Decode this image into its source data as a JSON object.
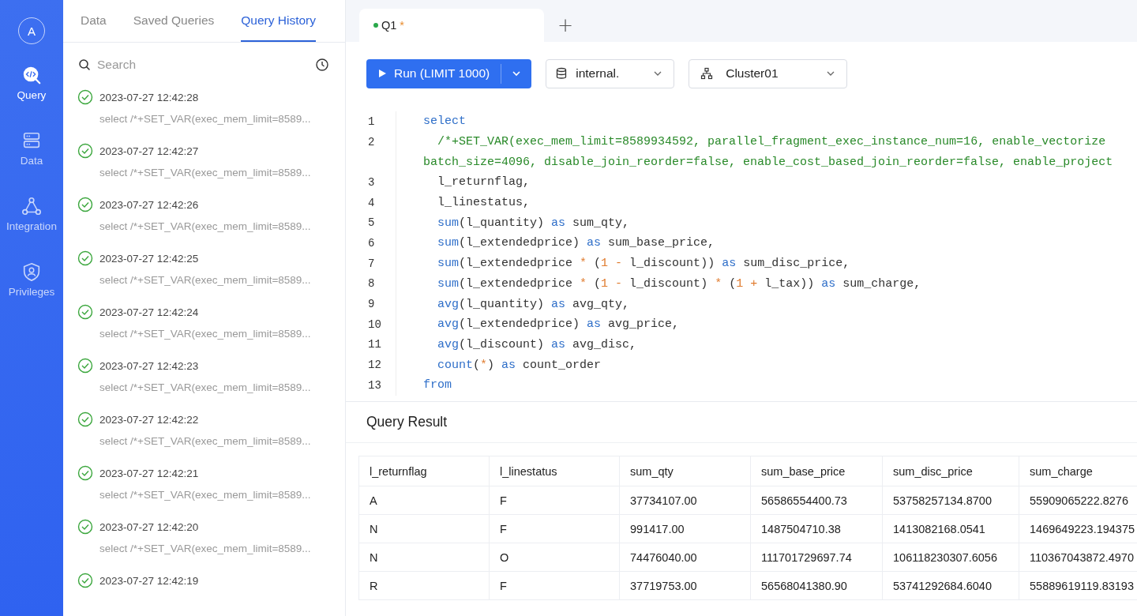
{
  "nav": {
    "avatar": "A",
    "items": [
      {
        "label": "Query",
        "selected": true
      },
      {
        "label": "Data",
        "selected": false
      },
      {
        "label": "Integration",
        "selected": false
      },
      {
        "label": "Privileges",
        "selected": false
      }
    ]
  },
  "panel": {
    "tabs": [
      {
        "label": "Data",
        "selected": false
      },
      {
        "label": "Saved Queries",
        "selected": false
      },
      {
        "label": "Query History",
        "selected": true
      }
    ],
    "search": {
      "placeholder": "Search"
    },
    "history": [
      {
        "time": "2023-07-27 12:42:28",
        "query": "select /*+SET_VAR(exec_mem_limit=8589..."
      },
      {
        "time": "2023-07-27 12:42:27",
        "query": "select /*+SET_VAR(exec_mem_limit=8589..."
      },
      {
        "time": "2023-07-27 12:42:26",
        "query": "select /*+SET_VAR(exec_mem_limit=8589..."
      },
      {
        "time": "2023-07-27 12:42:25",
        "query": "select /*+SET_VAR(exec_mem_limit=8589..."
      },
      {
        "time": "2023-07-27 12:42:24",
        "query": "select /*+SET_VAR(exec_mem_limit=8589..."
      },
      {
        "time": "2023-07-27 12:42:23",
        "query": "select /*+SET_VAR(exec_mem_limit=8589..."
      },
      {
        "time": "2023-07-27 12:42:22",
        "query": "select /*+SET_VAR(exec_mem_limit=8589..."
      },
      {
        "time": "2023-07-27 12:42:21",
        "query": "select /*+SET_VAR(exec_mem_limit=8589..."
      },
      {
        "time": "2023-07-27 12:42:20",
        "query": "select /*+SET_VAR(exec_mem_limit=8589..."
      },
      {
        "time": "2023-07-27 12:42:19"
      }
    ]
  },
  "editor_tabs": [
    {
      "label": "Q1",
      "modified_mark": "*",
      "selected": true
    }
  ],
  "new_tab": "+",
  "toolbar": {
    "run_button": "Run (LIMIT 1000)",
    "database": "internal.",
    "cluster": "Cluster01"
  },
  "code": [
    {
      "number": "1",
      "rows": [
        [
          {
            "kind": "keyword",
            "text": "select"
          }
        ]
      ]
    },
    {
      "number": "2",
      "rows": [
        [
          {
            "kind": "plain",
            "text": "  "
          },
          {
            "kind": "comment",
            "text": "/*+SET_VAR(exec_mem_limit=8589934592, parallel_fragment_exec_instance_num=16, enable_vectorize"
          }
        ],
        [
          {
            "kind": "comment",
            "text": "batch_size=4096, disable_join_reorder=false, enable_cost_based_join_reorder=false, enable_project"
          }
        ]
      ]
    },
    {
      "number": "3",
      "rows": [
        [
          {
            "kind": "plain",
            "text": "  l_returnflag,"
          }
        ]
      ]
    },
    {
      "number": "4",
      "rows": [
        [
          {
            "kind": "plain",
            "text": "  l_linestatus,"
          }
        ]
      ]
    },
    {
      "number": "5",
      "rows": [
        [
          {
            "kind": "plain",
            "text": "  "
          },
          {
            "kind": "keyword",
            "text": "sum"
          },
          {
            "kind": "plain",
            "text": "(l_quantity) "
          },
          {
            "kind": "keyword",
            "text": "as"
          },
          {
            "kind": "plain",
            "text": " sum_qty,"
          }
        ]
      ]
    },
    {
      "number": "6",
      "rows": [
        [
          {
            "kind": "plain",
            "text": "  "
          },
          {
            "kind": "keyword",
            "text": "sum"
          },
          {
            "kind": "plain",
            "text": "(l_extendedprice) "
          },
          {
            "kind": "keyword",
            "text": "as"
          },
          {
            "kind": "plain",
            "text": " sum_base_price,"
          }
        ]
      ]
    },
    {
      "number": "7",
      "rows": [
        [
          {
            "kind": "plain",
            "text": "  "
          },
          {
            "kind": "keyword",
            "text": "sum"
          },
          {
            "kind": "plain",
            "text": "(l_extendedprice "
          },
          {
            "kind": "operator",
            "text": "*"
          },
          {
            "kind": "plain",
            "text": " ("
          },
          {
            "kind": "operator",
            "text": "1 -"
          },
          {
            "kind": "plain",
            "text": " l_discount)) "
          },
          {
            "kind": "keyword",
            "text": "as"
          },
          {
            "kind": "plain",
            "text": " sum_disc_price,"
          }
        ]
      ]
    },
    {
      "number": "8",
      "rows": [
        [
          {
            "kind": "plain",
            "text": "  "
          },
          {
            "kind": "keyword",
            "text": "sum"
          },
          {
            "kind": "plain",
            "text": "(l_extendedprice "
          },
          {
            "kind": "operator",
            "text": "*"
          },
          {
            "kind": "plain",
            "text": " ("
          },
          {
            "kind": "operator",
            "text": "1 -"
          },
          {
            "kind": "plain",
            "text": " l_discount) "
          },
          {
            "kind": "operator",
            "text": "*"
          },
          {
            "kind": "plain",
            "text": " ("
          },
          {
            "kind": "operator",
            "text": "1 +"
          },
          {
            "kind": "plain",
            "text": " l_tax)) "
          },
          {
            "kind": "keyword",
            "text": "as"
          },
          {
            "kind": "plain",
            "text": " sum_charge,"
          }
        ]
      ]
    },
    {
      "number": "9",
      "rows": [
        [
          {
            "kind": "plain",
            "text": "  "
          },
          {
            "kind": "keyword",
            "text": "avg"
          },
          {
            "kind": "plain",
            "text": "(l_quantity) "
          },
          {
            "kind": "keyword",
            "text": "as"
          },
          {
            "kind": "plain",
            "text": " avg_qty,"
          }
        ]
      ]
    },
    {
      "number": "10",
      "rows": [
        [
          {
            "kind": "plain",
            "text": "  "
          },
          {
            "kind": "keyword",
            "text": "avg"
          },
          {
            "kind": "plain",
            "text": "(l_extendedprice) "
          },
          {
            "kind": "keyword",
            "text": "as"
          },
          {
            "kind": "plain",
            "text": " avg_price,"
          }
        ]
      ]
    },
    {
      "number": "11",
      "rows": [
        [
          {
            "kind": "plain",
            "text": "  "
          },
          {
            "kind": "keyword",
            "text": "avg"
          },
          {
            "kind": "plain",
            "text": "(l_discount) "
          },
          {
            "kind": "keyword",
            "text": "as"
          },
          {
            "kind": "plain",
            "text": " avg_disc,"
          }
        ]
      ]
    },
    {
      "number": "12",
      "rows": [
        [
          {
            "kind": "plain",
            "text": "  "
          },
          {
            "kind": "keyword",
            "text": "count"
          },
          {
            "kind": "plain",
            "text": "("
          },
          {
            "kind": "operator",
            "text": "*"
          },
          {
            "kind": "plain",
            "text": ") "
          },
          {
            "kind": "keyword",
            "text": "as"
          },
          {
            "kind": "plain",
            "text": " count_order"
          }
        ]
      ]
    },
    {
      "number": "13",
      "rows": [
        [
          {
            "kind": "keyword",
            "text": "from"
          }
        ]
      ]
    }
  ],
  "result": {
    "title": "Query Result",
    "columns": [
      "l_returnflag",
      "l_linestatus",
      "sum_qty",
      "sum_base_price",
      "sum_disc_price",
      "sum_charge"
    ],
    "rows": [
      [
        "A",
        "F",
        "37734107.00",
        "56586554400.73",
        "53758257134.8700",
        "55909065222.8276"
      ],
      [
        "N",
        "F",
        "991417.00",
        "1487504710.38",
        "1413082168.0541",
        "1469649223.194375"
      ],
      [
        "N",
        "O",
        "74476040.00",
        "111701729697.74",
        "106118230307.6056",
        "110367043872.4970"
      ],
      [
        "R",
        "F",
        "37719753.00",
        "56568041380.90",
        "53741292684.6040",
        "55889619119.83193"
      ]
    ]
  }
}
